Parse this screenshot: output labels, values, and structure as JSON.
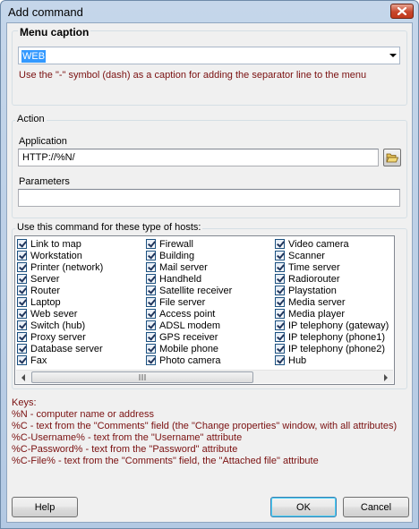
{
  "window": {
    "title": "Add command"
  },
  "menu_caption": {
    "label": "Menu caption",
    "value": "WEB",
    "note": "Use the \"-\" symbol (dash) as a caption for adding the separator line to the menu"
  },
  "action": {
    "legend": "Action",
    "application_label": "Application",
    "application_value": "HTTP://%N/",
    "parameters_label": "Parameters",
    "parameters_value": ""
  },
  "hosts": {
    "legend": "Use this command for these type of hosts:",
    "columns": [
      [
        "Link to map",
        "Workstation",
        "Printer (network)",
        "Server",
        "Router",
        "Laptop",
        "Web sever",
        "Switch (hub)",
        "Proxy server",
        "Database server",
        "Fax"
      ],
      [
        "Firewall",
        "Building",
        "Mail server",
        "Handheld",
        "Satellite receiver",
        "File server",
        "Access point",
        "ADSL modem",
        "GPS receiver",
        "Mobile phone",
        "Photo camera"
      ],
      [
        "Video camera",
        "Scanner",
        "Time server",
        "Radiorouter",
        "Playstation",
        "Media server",
        "Media player",
        "IP telephony (gateway)",
        "IP telephony (phone1)",
        "IP telephony (phone2)",
        "Hub"
      ]
    ]
  },
  "keys": {
    "title": "Keys:",
    "lines": [
      "%N - computer name or address",
      "%C - text from the \"Comments\" field (the \"Change properties\" window, with all attributes)",
      "%C-Username% - text from the \"Username\" attribute",
      "%C-Password% - text from the \"Password\" attribute",
      "%C-File% - text from the \"Comments\" field, the \"Attached file\" attribute"
    ]
  },
  "buttons": {
    "help": "Help",
    "ok": "OK",
    "cancel": "Cancel"
  },
  "icons": {
    "close": "close-icon",
    "browse": "folder-open-icon",
    "dropdown": "chevron-down-icon"
  }
}
